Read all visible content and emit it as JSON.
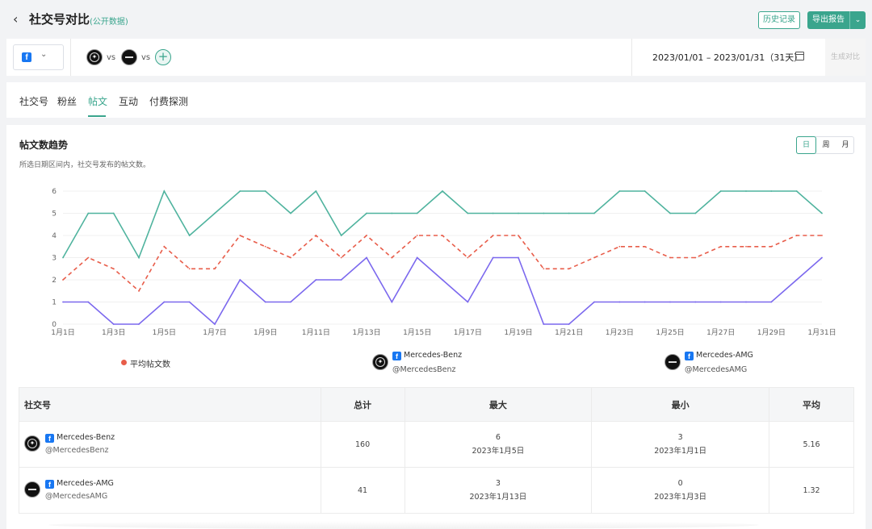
{
  "header": {
    "back_icon": "chevron-left-icon",
    "title": "社交号对比",
    "subtitle": "(公开数据)",
    "history_label": "历史记录",
    "export_label": "导出报告",
    "accent_color": "#3aa58d"
  },
  "selector": {
    "platform_icon": "facebook-icon",
    "vs1": "vs",
    "vs2": "vs",
    "add_label": "+",
    "date_range": "2023/01/01 – 2023/01/31（31天）",
    "generate_label": "生成对比"
  },
  "tabs": [
    {
      "label": "社交号"
    },
    {
      "label": "粉丝"
    },
    {
      "label": "帖文",
      "active": true
    },
    {
      "label": "互动"
    },
    {
      "label": "付费探测"
    }
  ],
  "card": {
    "title": "帖文数趋势",
    "description": "所选日期区间内，社交号发布的帖文数。",
    "granularity": [
      "日",
      "周",
      "月"
    ],
    "granularity_selected": "日"
  },
  "chart_data": {
    "type": "line",
    "x": [
      "1月1日",
      "1月2日",
      "1月3日",
      "1月4日",
      "1月5日",
      "1月6日",
      "1月7日",
      "1月8日",
      "1月9日",
      "1月10日",
      "1月11日",
      "1月12日",
      "1月13日",
      "1月14日",
      "1月15日",
      "1月16日",
      "1月17日",
      "1月18日",
      "1月19日",
      "1月20日",
      "1月21日",
      "1月22日",
      "1月23日",
      "1月24日",
      "1月25日",
      "1月26日",
      "1月27日",
      "1月28日",
      "1月29日",
      "1月30日",
      "1月31日"
    ],
    "x_tick_labels": [
      "1月1日",
      "1月3日",
      "1月5日",
      "1月7日",
      "1月9日",
      "1月11日",
      "1月13日",
      "1月15日",
      "1月17日",
      "1月19日",
      "1月21日",
      "1月23日",
      "1月25日",
      "1月27日",
      "1月29日",
      "1月31日"
    ],
    "yticks": [
      0,
      1,
      2,
      3,
      4,
      5,
      6
    ],
    "ylim": [
      0,
      6
    ],
    "grid": true,
    "series": [
      {
        "name": "Mercedes-Benz",
        "color": "#4fb39e",
        "style": "solid",
        "values": [
          3,
          5,
          5,
          3,
          6,
          4,
          5,
          6,
          6,
          5,
          6,
          4,
          5,
          5,
          5,
          6,
          5,
          5,
          5,
          5,
          5,
          5,
          6,
          6,
          5,
          5,
          6,
          6,
          6,
          6,
          5
        ]
      },
      {
        "name": "Mercedes-AMG",
        "color": "#7b68ee",
        "style": "solid",
        "values": [
          1,
          1,
          0,
          0,
          1,
          1,
          0,
          2,
          1,
          1,
          2,
          2,
          3,
          1,
          3,
          2,
          1,
          3,
          3,
          0,
          0,
          1,
          1,
          1,
          1,
          1,
          1,
          1,
          1,
          2,
          3
        ]
      },
      {
        "name": "平均帖文数",
        "color": "#e85d4a",
        "style": "dashed",
        "values": [
          2,
          3,
          2.5,
          1.5,
          3.5,
          2.5,
          2.5,
          4,
          3.5,
          3,
          4,
          3,
          4,
          3,
          4,
          4,
          3,
          4,
          4,
          2.5,
          2.5,
          3,
          3.5,
          3.5,
          3,
          3,
          3.5,
          3.5,
          3.5,
          4,
          4
        ]
      }
    ]
  },
  "legend": {
    "avg_label": "平均帖文数",
    "benz_name": "Mercedes-Benz",
    "benz_handle": "@MercedesBenz",
    "amg_name": "Mercedes-AMG",
    "amg_handle": "@MercedesAMG"
  },
  "table": {
    "headers": [
      "社交号",
      "总计",
      "最大",
      "最小",
      "平均"
    ],
    "rows": [
      {
        "name": "Mercedes-Benz",
        "handle": "@MercedesBenz",
        "total": "160",
        "max": "6",
        "max_date": "2023年1月5日",
        "min": "3",
        "min_date": "2023年1月1日",
        "avg": "5.16"
      },
      {
        "name": "Mercedes-AMG",
        "handle": "@MercedesAMG",
        "total": "41",
        "max": "3",
        "max_date": "2023年1月13日",
        "min": "0",
        "min_date": "2023年1月3日",
        "avg": "1.32"
      }
    ]
  }
}
